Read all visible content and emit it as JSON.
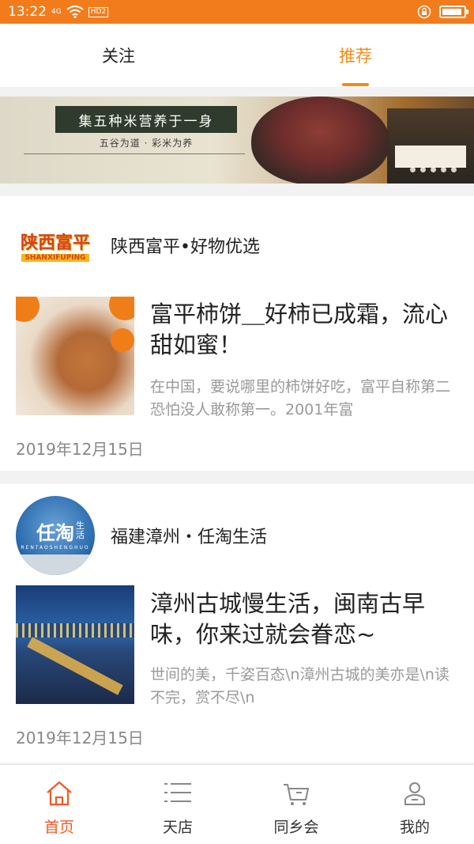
{
  "status_bar": {
    "time": "13:22",
    "net": "4G",
    "hd": "HD2"
  },
  "top_tabs": [
    {
      "label": "关注",
      "active": false
    },
    {
      "label": "推荐",
      "active": true
    }
  ],
  "banner": {
    "headline": "集五种米营养于一身",
    "sub": "五谷为道 · 彩米为养"
  },
  "articles": [
    {
      "source": "陕西富平•好物优选",
      "logo_text": "陕西富平",
      "logo_sub": "SHANXIFUPING",
      "title": "富平柿饼＿好柿已成霜，流心甜如蜜！",
      "desc": "在中国，要说哪里的柿饼好吃，富平自称第二恐怕没人敢称第一。2001年富",
      "date": "2019年12月15日"
    },
    {
      "source": "福建漳州・任淘生活",
      "logo_text": "任淘",
      "logo_side": "生活",
      "logo_sub": "RENTAOSHENGHUO",
      "title": "漳州古城慢生活，闽南古早味，你来过就会眷恋~",
      "desc": "世间的美，千姿百态\\n漳州古城的美亦是\\n读不完，赏不尽\\n",
      "date": "2019年12月15日"
    }
  ],
  "bottom_nav": [
    {
      "label": "首页",
      "icon": "home-icon",
      "active": true
    },
    {
      "label": "天店",
      "icon": "list-icon",
      "active": false
    },
    {
      "label": "同乡会",
      "icon": "cart-icon",
      "active": false
    },
    {
      "label": "我的",
      "icon": "user-icon",
      "active": false
    }
  ],
  "colors": {
    "accent": "#f08c1a",
    "status_bar": "#f27c1c",
    "nav_active": "#ef5a26"
  }
}
